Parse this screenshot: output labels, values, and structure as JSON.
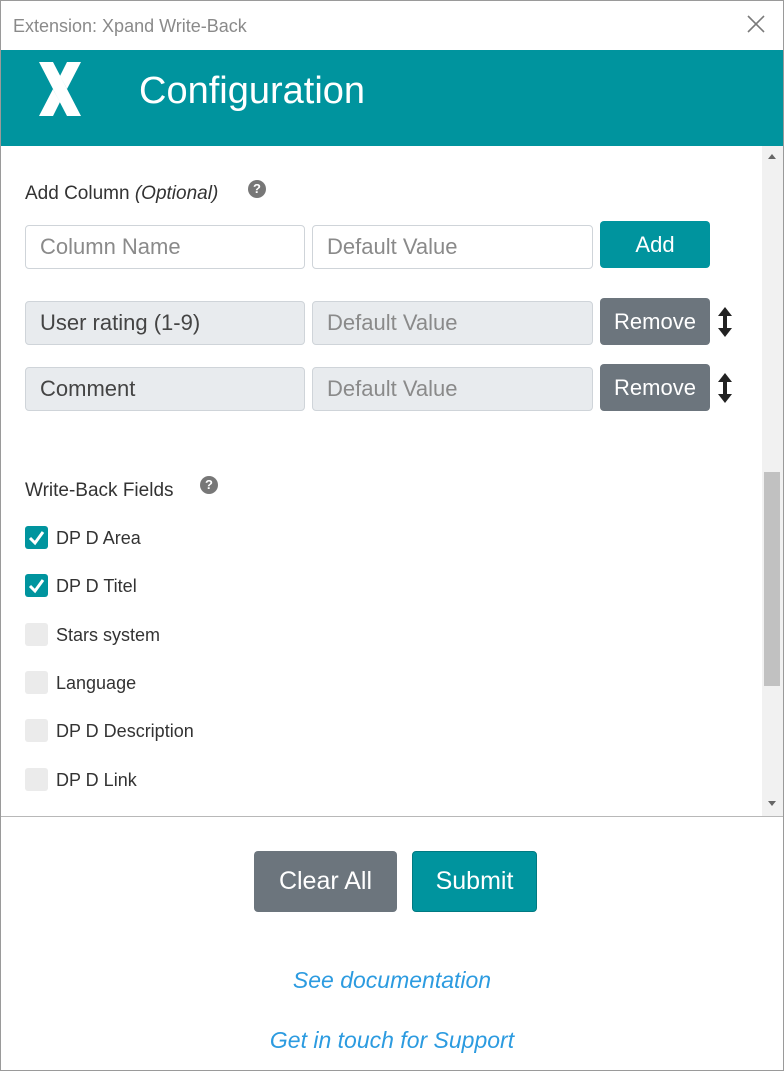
{
  "window": {
    "title": "Extension: Xpand Write-Back",
    "close_icon": "close-icon"
  },
  "header": {
    "title": "Configuration",
    "logo_icon": "x-logo-icon",
    "background_color": "#00949e"
  },
  "add_column": {
    "label": "Add Column",
    "optional_label": "(Optional)",
    "help_icon": "question-icon",
    "help_glyph": "?",
    "name_placeholder": "Column Name",
    "default_placeholder": "Default Value",
    "add_label": "Add",
    "columns": [
      {
        "name": "User rating (1-9)",
        "default_placeholder": "Default Value",
        "remove_label": "Remove"
      },
      {
        "name": "Comment",
        "default_placeholder": "Default Value",
        "remove_label": "Remove"
      }
    ]
  },
  "write_back_fields": {
    "label": "Write-Back Fields",
    "help_icon": "question-icon",
    "help_glyph": "?",
    "fields": [
      {
        "label": "DP D Area",
        "checked": true
      },
      {
        "label": "DP D Titel",
        "checked": true
      },
      {
        "label": "Stars system",
        "checked": false
      },
      {
        "label": "Language",
        "checked": false
      },
      {
        "label": "DP D Description",
        "checked": false
      },
      {
        "label": "DP D Link",
        "checked": false
      }
    ]
  },
  "footer": {
    "clear_label": "Clear All",
    "submit_label": "Submit",
    "documentation_link": "See documentation",
    "support_link": "Get in touch for Support"
  },
  "colors": {
    "accent": "#00949e",
    "secondary_button": "#6c757d",
    "link": "#2c9be0"
  }
}
